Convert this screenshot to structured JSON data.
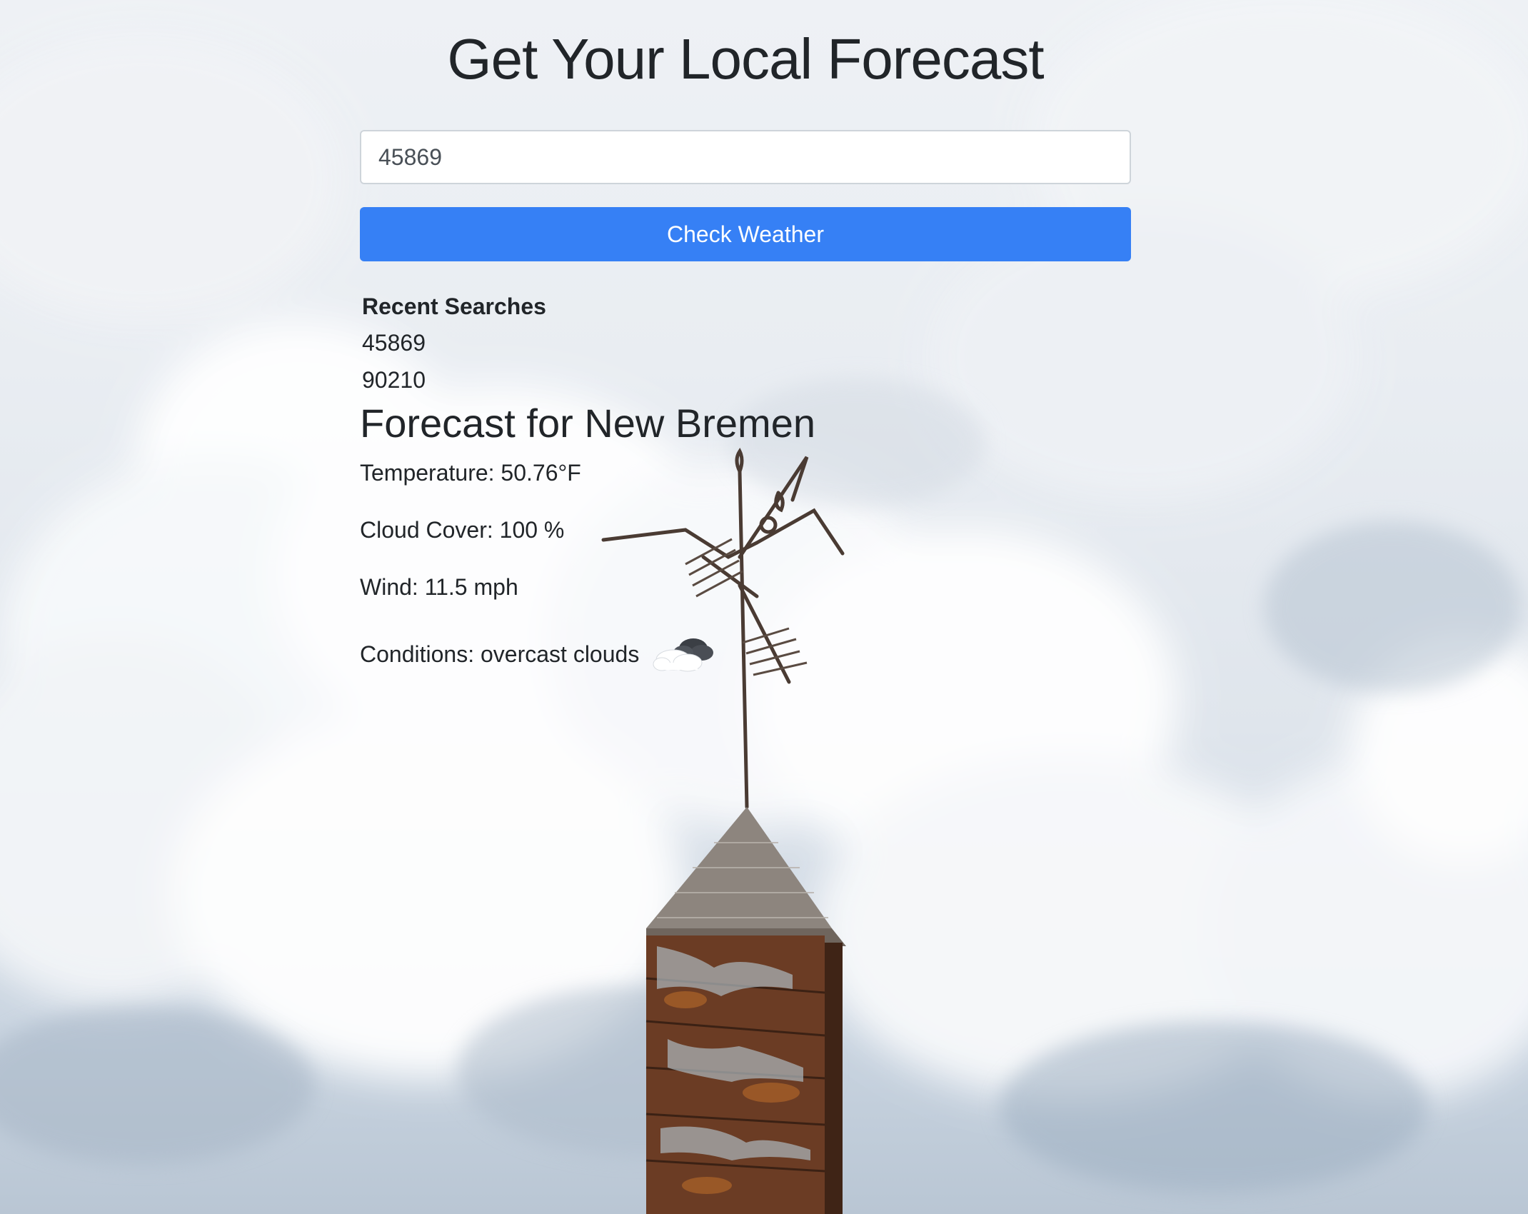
{
  "header": {
    "title": "Get Your Local Forecast"
  },
  "search": {
    "value": "45869",
    "button_label": "Check Weather"
  },
  "recent": {
    "heading": "Recent Searches",
    "items": [
      "45869",
      "90210"
    ]
  },
  "forecast": {
    "title": "Forecast for New Bremen",
    "temperature": "Temperature: 50.76°F",
    "cloud_cover": "Cloud Cover: 100 %",
    "wind": "Wind: 11.5 mph",
    "conditions": "Conditions: overcast clouds",
    "conditions_icon": "overcast-cloud-icon"
  },
  "colors": {
    "primary_button": "#3680f5",
    "text": "#212529"
  }
}
